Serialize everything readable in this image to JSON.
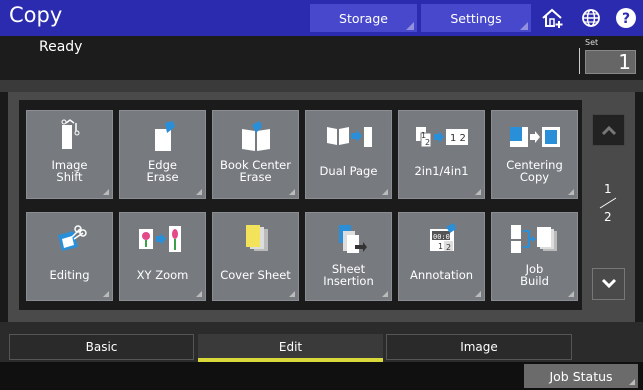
{
  "header": {
    "title": "Copy",
    "storage_label": "Storage",
    "settings_label": "Settings"
  },
  "status": {
    "text": "Ready",
    "set_label": "Set",
    "set_value": "1"
  },
  "functions": [
    {
      "label": "Image\nShift",
      "icon": "image-shift-icon"
    },
    {
      "label": "Edge\nErase",
      "icon": "edge-erase-icon"
    },
    {
      "label": "Book Center\nErase",
      "icon": "book-center-erase-icon"
    },
    {
      "label": "Dual Page",
      "icon": "dual-page-icon"
    },
    {
      "label": "2in1/4in1",
      "icon": "2in1-4in1-icon"
    },
    {
      "label": "Centering\nCopy",
      "icon": "centering-copy-icon"
    },
    {
      "label": "Editing",
      "icon": "editing-icon"
    },
    {
      "label": "XY Zoom",
      "icon": "xy-zoom-icon"
    },
    {
      "label": "Cover Sheet",
      "icon": "cover-sheet-icon"
    },
    {
      "label": "Sheet\nInsertion",
      "icon": "sheet-insertion-icon"
    },
    {
      "label": "Annotation",
      "icon": "annotation-icon"
    },
    {
      "label": "Job\nBuild",
      "icon": "job-build-icon"
    }
  ],
  "pagination": {
    "current": "1",
    "total": "2"
  },
  "tabs": [
    {
      "label": "Basic",
      "active": false
    },
    {
      "label": "Edit",
      "active": true
    },
    {
      "label": "Image",
      "active": false
    }
  ],
  "footer": {
    "job_status_label": "Job Status"
  },
  "colors": {
    "header_bg": "#2b2bb0",
    "header_button": "#4848cc",
    "tile_bg": "#777b80",
    "tab_active_underline": "#d8d83a",
    "icon_blue": "#2a8fd9"
  }
}
